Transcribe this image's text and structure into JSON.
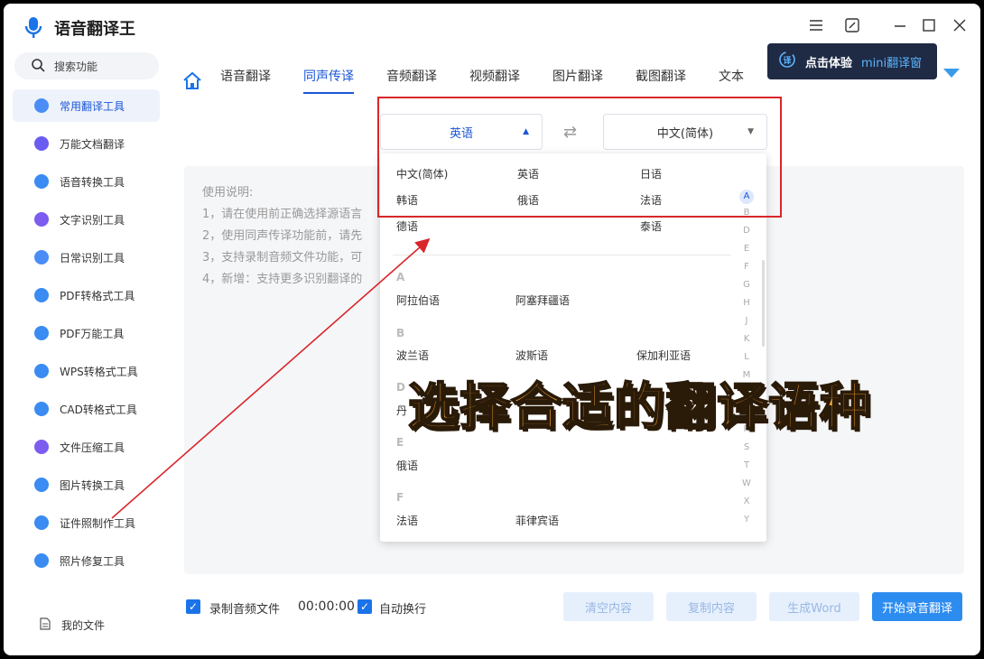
{
  "app": {
    "title": "语音翻译王"
  },
  "sidebar": {
    "search_placeholder": "搜索功能",
    "items": [
      {
        "label": "常用翻译工具",
        "icon": "a-icon",
        "color": "#4a8df6"
      },
      {
        "label": "万能文档翻译",
        "icon": "doc-icon",
        "color": "#6a5cf0"
      },
      {
        "label": "语音转换工具",
        "icon": "music-icon",
        "color": "#3a8bf2"
      },
      {
        "label": "文字识别工具",
        "icon": "text-icon",
        "color": "#7d5cf0"
      },
      {
        "label": "日常识别工具",
        "icon": "scan-icon",
        "color": "#4a8df6"
      },
      {
        "label": "PDF转格式工具",
        "icon": "pdf-icon",
        "color": "#3a8bf2"
      },
      {
        "label": "PDF万能工具",
        "icon": "pdf-list-icon",
        "color": "#3a8bf2"
      },
      {
        "label": "WPS转格式工具",
        "icon": "wps-icon",
        "color": "#3a8bf2"
      },
      {
        "label": "CAD转格式工具",
        "icon": "pen-icon",
        "color": "#3a8bf2"
      },
      {
        "label": "文件压缩工具",
        "icon": "zip-icon",
        "color": "#7d5cf0"
      },
      {
        "label": "图片转换工具",
        "icon": "image-icon",
        "color": "#3a8bf2"
      },
      {
        "label": "证件照制作工具",
        "icon": "person-icon",
        "color": "#3a8bf2"
      },
      {
        "label": "照片修复工具",
        "icon": "circle-icon",
        "color": "#3a8bf2"
      }
    ],
    "my_files": "我的文件"
  },
  "tooltip": {
    "prefix": "点击体验",
    "highlight": "mini翻译窗"
  },
  "tabs": [
    "语音翻译",
    "同声传译",
    "音频翻译",
    "视频翻译",
    "图片翻译",
    "截图翻译",
    "文本"
  ],
  "active_tab": "同声传译",
  "source_lang": "英语",
  "target_lang": "中文(简体)",
  "instructions": {
    "title": "使用说明:",
    "lines": [
      "1，请在使用前正确选择源语言",
      "2，使用同声传译功能前，请先",
      "3，支持录制音频文件功能，可",
      "4，新增：支持更多识别翻译的"
    ]
  },
  "dropdown": {
    "common": [
      "中文(简体)",
      "英语",
      "日语",
      "韩语",
      "俄语",
      "法语",
      "德语",
      "泰语"
    ],
    "groups": {
      "A": [
        "阿拉伯语",
        "阿塞拜疆语"
      ],
      "B": [
        "波兰语",
        "波斯语",
        "保加利亚语"
      ],
      "D": [
        "丹"
      ],
      "E": [
        "俄语"
      ],
      "F": [
        "法语",
        "菲律宾语"
      ]
    },
    "alphabet": [
      "A",
      "B",
      "D",
      "E",
      "F",
      "G",
      "H",
      "J",
      "K",
      "L",
      "M",
      "N",
      "P",
      "R",
      "S",
      "T",
      "W",
      "X",
      "Y"
    ]
  },
  "caption": "选择合适的翻译语种",
  "bottom": {
    "record_label": "录制音频文件",
    "timer": "00:00:00",
    "autowrap_label": "自动换行",
    "clear": "清空内容",
    "copy": "复制内容",
    "word": "生成Word",
    "start": "开始录音翻译"
  },
  "colors": {
    "accent": "#1a56d6",
    "primary_button": "#2d8cf0",
    "highlight_box": "#d9262b",
    "caption": "#f4a436"
  }
}
